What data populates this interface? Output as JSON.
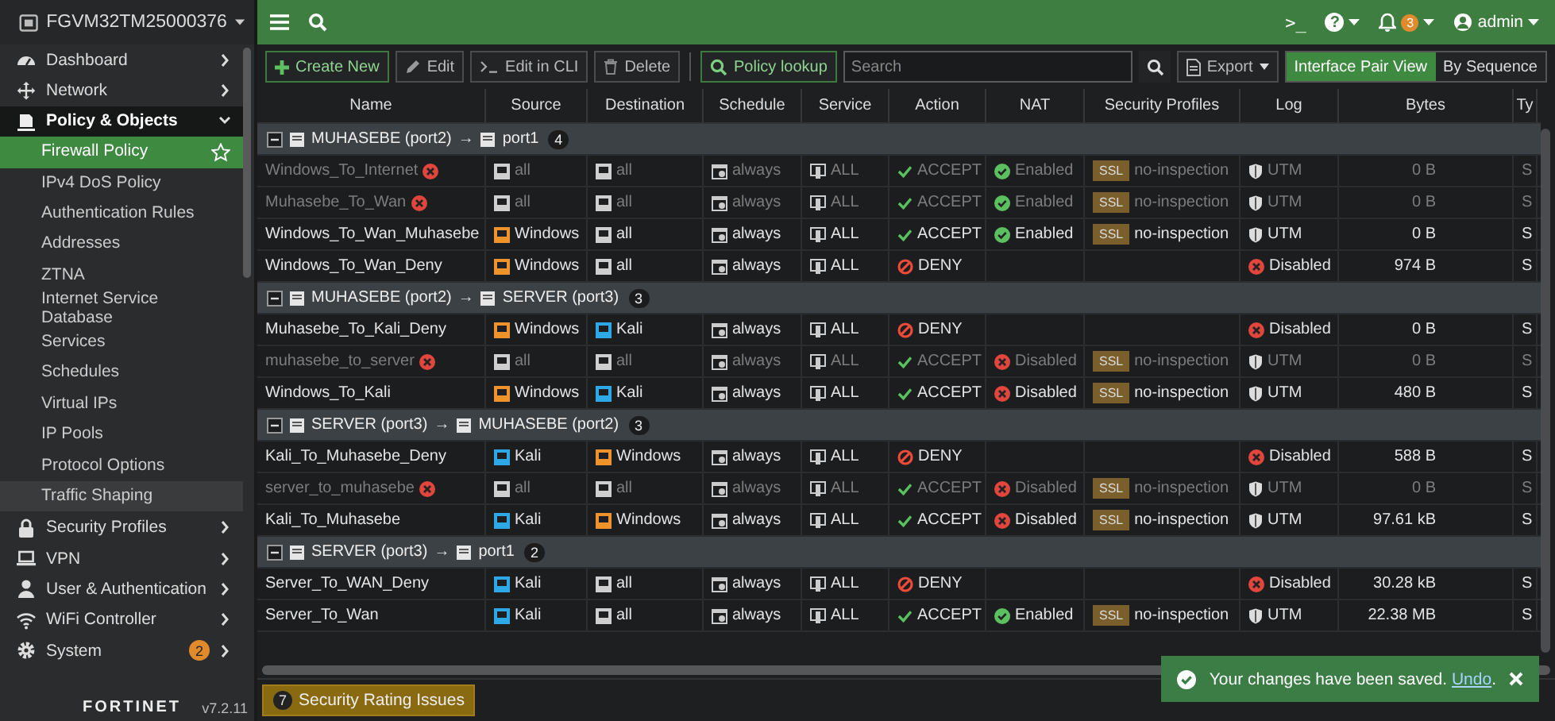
{
  "device": {
    "name": "FGVM32TM25000376"
  },
  "sidebar": {
    "items": [
      {
        "label": "Dashboard",
        "kind": "dashboard",
        "expanded": false
      },
      {
        "label": "Network",
        "kind": "network",
        "expanded": false
      },
      {
        "label": "Policy & Objects",
        "kind": "policy",
        "expanded": true,
        "children": [
          {
            "label": "Firewall Policy",
            "selected": true,
            "highlighted": false
          },
          {
            "label": "IPv4 DoS Policy",
            "selected": false,
            "highlighted": false
          },
          {
            "label": "Authentication Rules",
            "selected": false,
            "highlighted": false
          },
          {
            "label": "Addresses",
            "selected": false,
            "highlighted": false
          },
          {
            "label": "ZTNA",
            "selected": false,
            "highlighted": false
          },
          {
            "label": "Internet Service Database",
            "selected": false,
            "highlighted": false
          },
          {
            "label": "Services",
            "selected": false,
            "highlighted": false
          },
          {
            "label": "Schedules",
            "selected": false,
            "highlighted": false
          },
          {
            "label": "Virtual IPs",
            "selected": false,
            "highlighted": false
          },
          {
            "label": "IP Pools",
            "selected": false,
            "highlighted": false
          },
          {
            "label": "Protocol Options",
            "selected": false,
            "highlighted": false
          },
          {
            "label": "Traffic Shaping",
            "selected": false,
            "highlighted": true
          }
        ]
      },
      {
        "label": "Security Profiles",
        "kind": "lock",
        "expanded": false
      },
      {
        "label": "VPN",
        "kind": "laptop",
        "expanded": false
      },
      {
        "label": "User & Authentication",
        "kind": "user",
        "expanded": false
      },
      {
        "label": "WiFi Controller",
        "kind": "wifi",
        "expanded": false
      },
      {
        "label": "System",
        "kind": "gear",
        "expanded": false,
        "badge": "2"
      }
    ]
  },
  "brand": {
    "logo": "FORTINET",
    "version": "v7.2.11"
  },
  "topbar": {
    "cli": ">_",
    "help": "?",
    "notifications": "3",
    "user": "admin"
  },
  "toolbar": {
    "buttons": [
      {
        "label": "Create New",
        "kind": "create"
      },
      {
        "label": "Edit",
        "kind": "edit"
      },
      {
        "label": "Edit in CLI",
        "kind": "cli"
      },
      {
        "label": "Delete",
        "kind": "delete"
      },
      {
        "label": "Policy lookup",
        "kind": "lookup"
      }
    ],
    "search": {
      "placeholder": "Search"
    },
    "export": "Export",
    "views": [
      {
        "label": "Interface Pair View",
        "selected": true
      },
      {
        "label": "By Sequence",
        "selected": false
      }
    ]
  },
  "table": {
    "columns": [
      "Name",
      "Source",
      "Destination",
      "Schedule",
      "Service",
      "Action",
      "NAT",
      "Security Profiles",
      "Log",
      "Bytes",
      "Ty"
    ],
    "groups": [
      {
        "from": "MUHASEBE (port2)",
        "arrow": "→",
        "to": "port1",
        "count": "4",
        "expanded": true,
        "rows": [
          {
            "name": "Windows_To_Internet",
            "enabled": false,
            "source": {
              "label": "all",
              "color": "#cfcfcf"
            },
            "destination": {
              "label": "all",
              "color": "#cfcfcf"
            },
            "schedule": "always",
            "service": "ALL",
            "action": {
              "label": "ACCEPT",
              "kind": "accept"
            },
            "nat": {
              "label": "Enabled",
              "on": true
            },
            "profile": {
              "badge": "SSL",
              "label": "no-inspection"
            },
            "log": {
              "label": "UTM",
              "kind": "utm"
            },
            "bytes": "0 B",
            "column_11": "S"
          },
          {
            "name": "Muhasebe_To_Wan",
            "enabled": false,
            "source": {
              "label": "all",
              "color": "#cfcfcf"
            },
            "destination": {
              "label": "all",
              "color": "#cfcfcf"
            },
            "schedule": "always",
            "service": "ALL",
            "action": {
              "label": "ACCEPT",
              "kind": "accept"
            },
            "nat": {
              "label": "Enabled",
              "on": true
            },
            "profile": {
              "badge": "SSL",
              "label": "no-inspection"
            },
            "log": {
              "label": "UTM",
              "kind": "utm"
            },
            "bytes": "0 B",
            "column_11": "S"
          },
          {
            "name": "Windows_To_Wan_Muhasebe",
            "enabled": true,
            "source": {
              "label": "Windows",
              "color": "#f0932b"
            },
            "destination": {
              "label": "all",
              "color": "#cfcfcf"
            },
            "schedule": "always",
            "service": "ALL",
            "action": {
              "label": "ACCEPT",
              "kind": "accept"
            },
            "nat": {
              "label": "Enabled",
              "on": true
            },
            "profile": {
              "badge": "SSL",
              "label": "no-inspection"
            },
            "log": {
              "label": "UTM",
              "kind": "utm"
            },
            "bytes": "0 B",
            "column_11": "S"
          },
          {
            "name": "Windows_To_Wan_Deny",
            "enabled": true,
            "source": {
              "label": "Windows",
              "color": "#f0932b"
            },
            "destination": {
              "label": "all",
              "color": "#cfcfcf"
            },
            "schedule": "always",
            "service": "ALL",
            "action": {
              "label": "DENY",
              "kind": "deny"
            },
            "log": {
              "label": "Disabled",
              "kind": "disabled"
            },
            "bytes": "974 B",
            "column_11": "S"
          }
        ]
      },
      {
        "from": "MUHASEBE (port2)",
        "arrow": "→",
        "to": "SERVER (port3)",
        "count": "3",
        "expanded": true,
        "rows": [
          {
            "name": "Muhasebe_To_Kali_Deny",
            "enabled": true,
            "source": {
              "label": "Windows",
              "color": "#f0932b"
            },
            "destination": {
              "label": "Kali",
              "color": "#2fa8e8"
            },
            "schedule": "always",
            "service": "ALL",
            "action": {
              "label": "DENY",
              "kind": "deny"
            },
            "log": {
              "label": "Disabled",
              "kind": "disabled"
            },
            "bytes": "0 B",
            "column_11": "S"
          },
          {
            "name": "muhasebe_to_server",
            "enabled": false,
            "source": {
              "label": "all",
              "color": "#cfcfcf"
            },
            "destination": {
              "label": "all",
              "color": "#cfcfcf"
            },
            "schedule": "always",
            "service": "ALL",
            "action": {
              "label": "ACCEPT",
              "kind": "accept"
            },
            "nat": {
              "label": "Disabled",
              "on": false
            },
            "profile": {
              "badge": "SSL",
              "label": "no-inspection"
            },
            "log": {
              "label": "UTM",
              "kind": "utm"
            },
            "bytes": "0 B",
            "column_11": "S"
          },
          {
            "name": "Windows_To_Kali",
            "enabled": true,
            "source": {
              "label": "Windows",
              "color": "#f0932b"
            },
            "destination": {
              "label": "Kali",
              "color": "#2fa8e8"
            },
            "schedule": "always",
            "service": "ALL",
            "action": {
              "label": "ACCEPT",
              "kind": "accept"
            },
            "nat": {
              "label": "Disabled",
              "on": false
            },
            "profile": {
              "badge": "SSL",
              "label": "no-inspection"
            },
            "log": {
              "label": "UTM",
              "kind": "utm"
            },
            "bytes": "480 B",
            "column_11": "S"
          }
        ]
      },
      {
        "from": "SERVER (port3)",
        "arrow": "→",
        "to": "MUHASEBE (port2)",
        "count": "3",
        "expanded": true,
        "rows": [
          {
            "name": "Kali_To_Muhasebe_Deny",
            "enabled": true,
            "source": {
              "label": "Kali",
              "color": "#2fa8e8"
            },
            "destination": {
              "label": "Windows",
              "color": "#f0932b"
            },
            "schedule": "always",
            "service": "ALL",
            "action": {
              "label": "DENY",
              "kind": "deny"
            },
            "log": {
              "label": "Disabled",
              "kind": "disabled"
            },
            "bytes": "588 B",
            "column_11": "S"
          },
          {
            "name": "server_to_muhasebe",
            "enabled": false,
            "source": {
              "label": "all",
              "color": "#cfcfcf"
            },
            "destination": {
              "label": "all",
              "color": "#cfcfcf"
            },
            "schedule": "always",
            "service": "ALL",
            "action": {
              "label": "ACCEPT",
              "kind": "accept"
            },
            "nat": {
              "label": "Disabled",
              "on": false
            },
            "profile": {
              "badge": "SSL",
              "label": "no-inspection"
            },
            "log": {
              "label": "UTM",
              "kind": "utm"
            },
            "bytes": "0 B",
            "column_11": "S"
          },
          {
            "name": "Kali_To_Muhasebe",
            "enabled": true,
            "source": {
              "label": "Kali",
              "color": "#2fa8e8"
            },
            "destination": {
              "label": "Windows",
              "color": "#f0932b"
            },
            "schedule": "always",
            "service": "ALL",
            "action": {
              "label": "ACCEPT",
              "kind": "accept"
            },
            "nat": {
              "label": "Disabled",
              "on": false
            },
            "profile": {
              "badge": "SSL",
              "label": "no-inspection"
            },
            "log": {
              "label": "UTM",
              "kind": "utm"
            },
            "bytes": "97.61 kB",
            "column_11": "S"
          }
        ]
      },
      {
        "from": "SERVER (port3)",
        "arrow": "→",
        "to": "port1",
        "count": "2",
        "expanded": true,
        "rows": [
          {
            "name": "Server_To_WAN_Deny",
            "enabled": true,
            "source": {
              "label": "Kali",
              "color": "#2fa8e8"
            },
            "destination": {
              "label": "all",
              "color": "#cfcfcf"
            },
            "schedule": "always",
            "service": "ALL",
            "action": {
              "label": "DENY",
              "kind": "deny"
            },
            "log": {
              "label": "Disabled",
              "kind": "disabled"
            },
            "bytes": "30.28 kB",
            "column_11": "S"
          },
          {
            "name": "Server_To_Wan",
            "enabled": true,
            "source": {
              "label": "Kali",
              "color": "#2fa8e8"
            },
            "destination": {
              "label": "all",
              "color": "#cfcfcf"
            },
            "schedule": "always",
            "service": "ALL",
            "action": {
              "label": "ACCEPT",
              "kind": "accept"
            },
            "nat": {
              "label": "Enabled",
              "on": true
            },
            "profile": {
              "badge": "SSL",
              "label": "no-inspection"
            },
            "log": {
              "label": "UTM",
              "kind": "utm"
            },
            "bytes": "22.38 MB",
            "column_11": "S"
          }
        ]
      }
    ]
  },
  "footer": {
    "rating": {
      "count": "7",
      "label": "Security Rating Issues"
    }
  },
  "toast": {
    "message": "Your changes have been saved. ",
    "link": "Undo",
    "tail": "."
  }
}
